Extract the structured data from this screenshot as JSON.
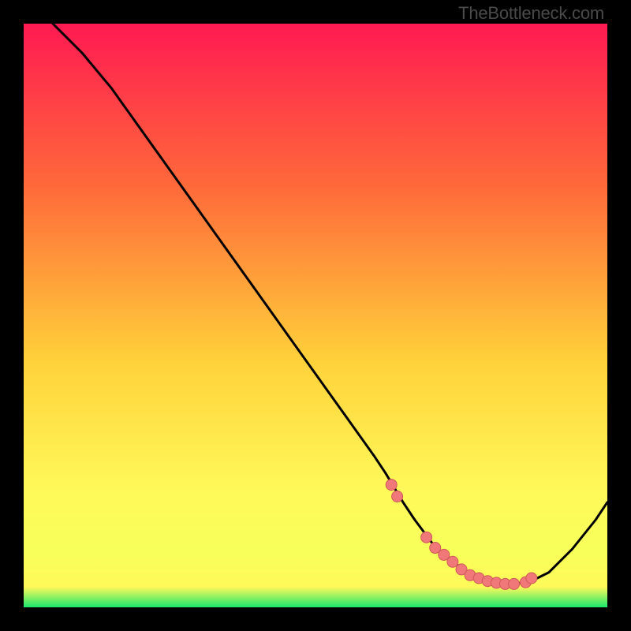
{
  "watermark": "TheBottleneck.com",
  "colors": {
    "bg": "#000000",
    "gradient_top": "#ff1a52",
    "gradient_mid_upper": "#ff6a3a",
    "gradient_mid": "#ffd23a",
    "gradient_mid_lower": "#fff95a",
    "gradient_low_band": "#f7ff5a",
    "gradient_bottom": "#1ae86b",
    "curve": "#000000",
    "marker_fill": "#f07878",
    "marker_stroke": "#d05858"
  },
  "chart_data": {
    "type": "line",
    "title": "",
    "xlabel": "",
    "ylabel": "",
    "xlim": [
      0,
      100
    ],
    "ylim": [
      0,
      100
    ],
    "series": [
      {
        "name": "bottleneck-curve",
        "x": [
          5,
          10,
          15,
          20,
          25,
          30,
          35,
          40,
          45,
          50,
          55,
          60,
          62,
          65,
          67,
          70,
          72,
          74,
          76,
          78,
          80,
          82,
          84,
          86,
          88,
          90,
          94,
          98,
          100
        ],
        "y": [
          100,
          95,
          89,
          82,
          75,
          68,
          61,
          54,
          47,
          40,
          33,
          26,
          23,
          18,
          15,
          11,
          9,
          7.5,
          6,
          5,
          4.3,
          4,
          4,
          4.3,
          5,
          6,
          10,
          15,
          18
        ]
      }
    ],
    "markers": {
      "name": "highlight-points",
      "x": [
        63,
        64,
        69,
        70.5,
        72,
        73.5,
        75,
        76.5,
        78,
        79.5,
        81,
        82.5,
        84,
        86,
        87
      ],
      "y": [
        21,
        19,
        12,
        10.2,
        9,
        7.8,
        6.5,
        5.5,
        5,
        4.5,
        4.2,
        4,
        4,
        4.3,
        5
      ]
    }
  }
}
